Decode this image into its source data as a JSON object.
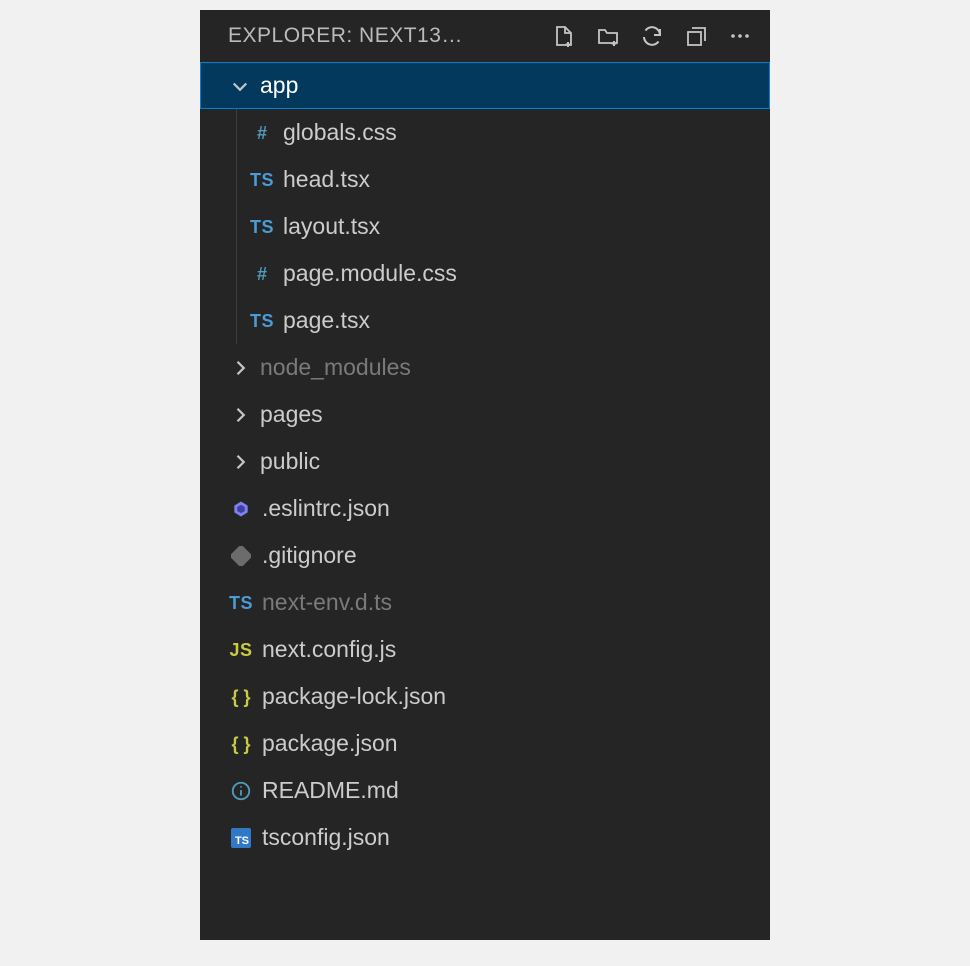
{
  "header": {
    "title": "EXPLORER: NEXT13…"
  },
  "tree": {
    "root": {
      "name": "app"
    },
    "appChildren": [
      {
        "name": "globals.css",
        "icon": "hash"
      },
      {
        "name": "head.tsx",
        "icon": "ts"
      },
      {
        "name": "layout.tsx",
        "icon": "ts"
      },
      {
        "name": "page.module.css",
        "icon": "hash"
      },
      {
        "name": "page.tsx",
        "icon": "ts"
      }
    ],
    "siblings": [
      {
        "name": "node_modules",
        "type": "folder",
        "dim": true
      },
      {
        "name": "pages",
        "type": "folder"
      },
      {
        "name": "public",
        "type": "folder"
      },
      {
        "name": ".eslintrc.json",
        "icon": "eslint"
      },
      {
        "name": ".gitignore",
        "icon": "git"
      },
      {
        "name": "next-env.d.ts",
        "icon": "ts",
        "dim": true
      },
      {
        "name": "next.config.js",
        "icon": "js"
      },
      {
        "name": "package-lock.json",
        "icon": "json"
      },
      {
        "name": "package.json",
        "icon": "json"
      },
      {
        "name": "README.md",
        "icon": "info"
      },
      {
        "name": "tsconfig.json",
        "icon": "tsbox"
      }
    ]
  }
}
